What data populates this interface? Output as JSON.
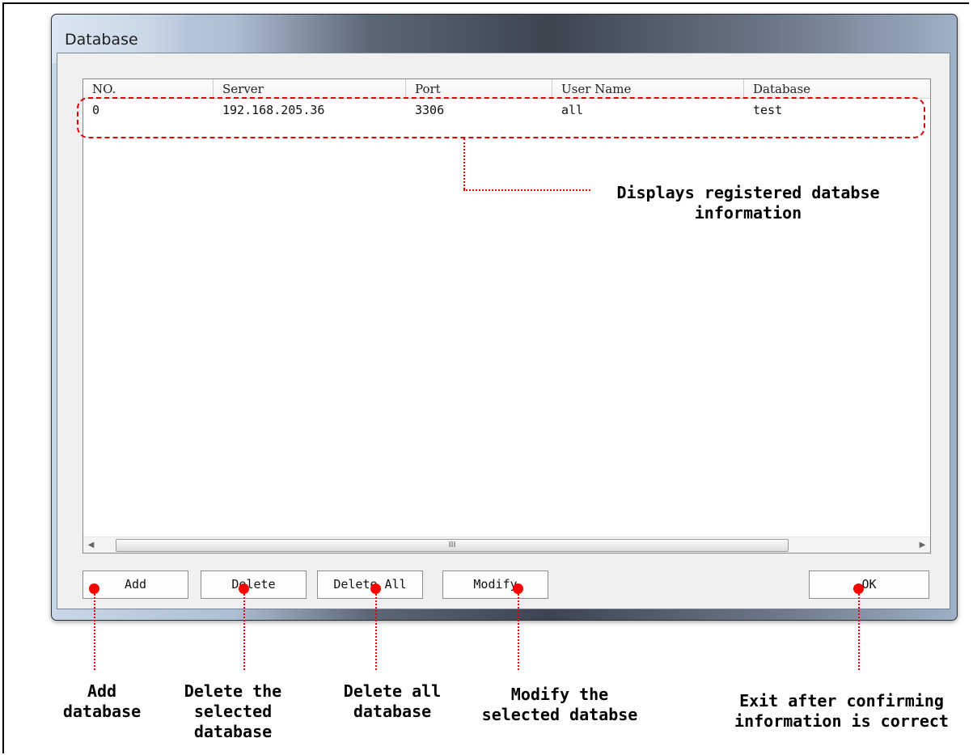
{
  "window": {
    "title": "Database"
  },
  "listview": {
    "columns": [
      "NO.",
      "Server",
      "Port",
      "User Name",
      "Database"
    ],
    "rows": [
      {
        "no": "0",
        "server": "192.168.205.36",
        "port": "3306",
        "user": "all",
        "database": "test"
      }
    ],
    "scroll_grip": "III"
  },
  "buttons": {
    "add": "Add",
    "delete": "Delete",
    "delete_all": "Delete All",
    "modify": "Modify",
    "ok": "OK"
  },
  "annotations": {
    "list_info": "Displays registered databse\ninformation",
    "add": "Add\ndatabase",
    "delete": "Delete the\nselected\ndatabase",
    "delete_all": "Delete all\ndatabase",
    "modify": "Modify the\nselected databse",
    "ok": "Exit after confirming\ninformation is correct"
  },
  "colors": {
    "annotation_red": "#e00000"
  }
}
